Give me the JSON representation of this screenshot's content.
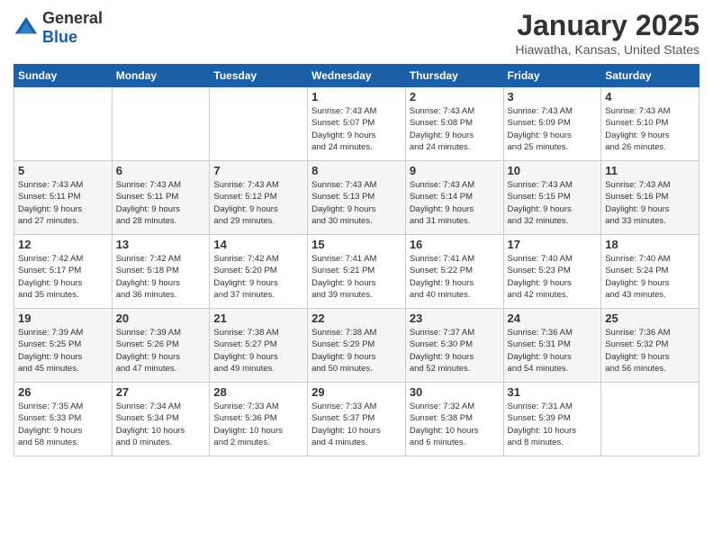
{
  "header": {
    "logo_general": "General",
    "logo_blue": "Blue",
    "title": "January 2025",
    "subtitle": "Hiawatha, Kansas, United States"
  },
  "weekdays": [
    "Sunday",
    "Monday",
    "Tuesday",
    "Wednesday",
    "Thursday",
    "Friday",
    "Saturday"
  ],
  "weeks": [
    [
      {
        "day": "",
        "info": ""
      },
      {
        "day": "",
        "info": ""
      },
      {
        "day": "",
        "info": ""
      },
      {
        "day": "1",
        "info": "Sunrise: 7:43 AM\nSunset: 5:07 PM\nDaylight: 9 hours\nand 24 minutes."
      },
      {
        "day": "2",
        "info": "Sunrise: 7:43 AM\nSunset: 5:08 PM\nDaylight: 9 hours\nand 24 minutes."
      },
      {
        "day": "3",
        "info": "Sunrise: 7:43 AM\nSunset: 5:09 PM\nDaylight: 9 hours\nand 25 minutes."
      },
      {
        "day": "4",
        "info": "Sunrise: 7:43 AM\nSunset: 5:10 PM\nDaylight: 9 hours\nand 26 minutes."
      }
    ],
    [
      {
        "day": "5",
        "info": "Sunrise: 7:43 AM\nSunset: 5:11 PM\nDaylight: 9 hours\nand 27 minutes."
      },
      {
        "day": "6",
        "info": "Sunrise: 7:43 AM\nSunset: 5:11 PM\nDaylight: 9 hours\nand 28 minutes."
      },
      {
        "day": "7",
        "info": "Sunrise: 7:43 AM\nSunset: 5:12 PM\nDaylight: 9 hours\nand 29 minutes."
      },
      {
        "day": "8",
        "info": "Sunrise: 7:43 AM\nSunset: 5:13 PM\nDaylight: 9 hours\nand 30 minutes."
      },
      {
        "day": "9",
        "info": "Sunrise: 7:43 AM\nSunset: 5:14 PM\nDaylight: 9 hours\nand 31 minutes."
      },
      {
        "day": "10",
        "info": "Sunrise: 7:43 AM\nSunset: 5:15 PM\nDaylight: 9 hours\nand 32 minutes."
      },
      {
        "day": "11",
        "info": "Sunrise: 7:43 AM\nSunset: 5:16 PM\nDaylight: 9 hours\nand 33 minutes."
      }
    ],
    [
      {
        "day": "12",
        "info": "Sunrise: 7:42 AM\nSunset: 5:17 PM\nDaylight: 9 hours\nand 35 minutes."
      },
      {
        "day": "13",
        "info": "Sunrise: 7:42 AM\nSunset: 5:18 PM\nDaylight: 9 hours\nand 36 minutes."
      },
      {
        "day": "14",
        "info": "Sunrise: 7:42 AM\nSunset: 5:20 PM\nDaylight: 9 hours\nand 37 minutes."
      },
      {
        "day": "15",
        "info": "Sunrise: 7:41 AM\nSunset: 5:21 PM\nDaylight: 9 hours\nand 39 minutes."
      },
      {
        "day": "16",
        "info": "Sunrise: 7:41 AM\nSunset: 5:22 PM\nDaylight: 9 hours\nand 40 minutes."
      },
      {
        "day": "17",
        "info": "Sunrise: 7:40 AM\nSunset: 5:23 PM\nDaylight: 9 hours\nand 42 minutes."
      },
      {
        "day": "18",
        "info": "Sunrise: 7:40 AM\nSunset: 5:24 PM\nDaylight: 9 hours\nand 43 minutes."
      }
    ],
    [
      {
        "day": "19",
        "info": "Sunrise: 7:39 AM\nSunset: 5:25 PM\nDaylight: 9 hours\nand 45 minutes."
      },
      {
        "day": "20",
        "info": "Sunrise: 7:39 AM\nSunset: 5:26 PM\nDaylight: 9 hours\nand 47 minutes."
      },
      {
        "day": "21",
        "info": "Sunrise: 7:38 AM\nSunset: 5:27 PM\nDaylight: 9 hours\nand 49 minutes."
      },
      {
        "day": "22",
        "info": "Sunrise: 7:38 AM\nSunset: 5:29 PM\nDaylight: 9 hours\nand 50 minutes."
      },
      {
        "day": "23",
        "info": "Sunrise: 7:37 AM\nSunset: 5:30 PM\nDaylight: 9 hours\nand 52 minutes."
      },
      {
        "day": "24",
        "info": "Sunrise: 7:36 AM\nSunset: 5:31 PM\nDaylight: 9 hours\nand 54 minutes."
      },
      {
        "day": "25",
        "info": "Sunrise: 7:36 AM\nSunset: 5:32 PM\nDaylight: 9 hours\nand 56 minutes."
      }
    ],
    [
      {
        "day": "26",
        "info": "Sunrise: 7:35 AM\nSunset: 5:33 PM\nDaylight: 9 hours\nand 58 minutes."
      },
      {
        "day": "27",
        "info": "Sunrise: 7:34 AM\nSunset: 5:34 PM\nDaylight: 10 hours\nand 0 minutes."
      },
      {
        "day": "28",
        "info": "Sunrise: 7:33 AM\nSunset: 5:36 PM\nDaylight: 10 hours\nand 2 minutes."
      },
      {
        "day": "29",
        "info": "Sunrise: 7:33 AM\nSunset: 5:37 PM\nDaylight: 10 hours\nand 4 minutes."
      },
      {
        "day": "30",
        "info": "Sunrise: 7:32 AM\nSunset: 5:38 PM\nDaylight: 10 hours\nand 6 minutes."
      },
      {
        "day": "31",
        "info": "Sunrise: 7:31 AM\nSunset: 5:39 PM\nDaylight: 10 hours\nand 8 minutes."
      },
      {
        "day": "",
        "info": ""
      }
    ]
  ]
}
